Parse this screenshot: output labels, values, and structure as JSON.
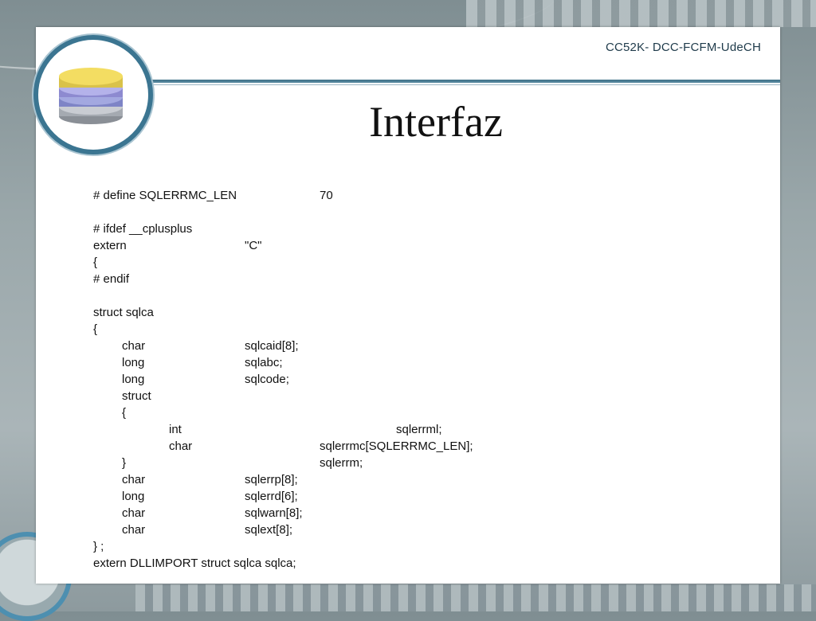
{
  "header": {
    "course": "CC52K- DCC-FCFM-UdeCH",
    "title": "Interfaz"
  },
  "code_lines": [
    "# define SQLERRMC_LEN",
    "70",
    "# ifdef __cplusplus",
    "extern",
    "\"C\"",
    "{",
    "# endif",
    "struct sqlca",
    "{",
    "char",
    "sqlcaid[8];",
    "long",
    "sqlabc;",
    "long",
    "sqlcode;",
    "struct",
    "{",
    "int",
    "sqlerrml;",
    "char",
    "sqlerrmc[SQLERRMC_LEN];",
    "}",
    "sqlerrm;",
    "char",
    "sqlerrp[8];",
    "long",
    "sqlerrd[6];",
    "char",
    "sqlwarn[8];",
    "char",
    "sqlext[8];",
    "} ;",
    "extern DLLIMPORT struct sqlca sqlca;"
  ],
  "colors": {
    "accent": "#3b7591",
    "slide_bg": "#ffffff",
    "text": "#111111"
  },
  "icons": {
    "logo": "database-icon"
  }
}
